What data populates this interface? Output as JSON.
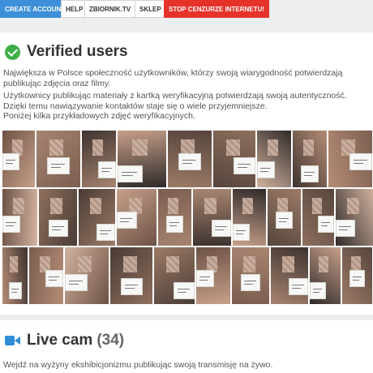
{
  "navbar": {
    "create_account": "CREATE ACCOUNT",
    "help": "HELP",
    "zbiornik_tv": "ZBIORNIK.TV",
    "shop": "SKLEP",
    "stop_censorship": "STOP CENZURZE INTERNETU!"
  },
  "verified": {
    "title": "Verified users",
    "icon": "check-circle-icon",
    "paragraph1": "Największa w Polsce społeczność użytkowników, którzy swoją wiarygodność potwierdzają publikując zdjęcia oraz filmy.",
    "paragraph2_lines": [
      "Użytkownicy publikując materiały z kartką weryfikacyjną potwierdzają swoją autentyczność.",
      "Dzięki temu nawiązywanie kontaktów staje się o wiele przyjemniejsze.",
      "Poniżej kilka przykładowych zdjęć weryfikacyjnych."
    ],
    "photo_count": 30
  },
  "live_cam": {
    "title": "Live cam",
    "count": "(34)",
    "icon": "video-camera-icon",
    "paragraph_lines": [
      "Wejdź na wyżyny ekshibicjonizmu publikując swoją transmisję na żywo."
    ]
  },
  "colors": {
    "primary": "#3c8fd8",
    "danger": "#e5332a",
    "success": "#3fae49",
    "camera": "#2d8ed6",
    "background": "#eceef0",
    "panel": "#ffffff"
  }
}
